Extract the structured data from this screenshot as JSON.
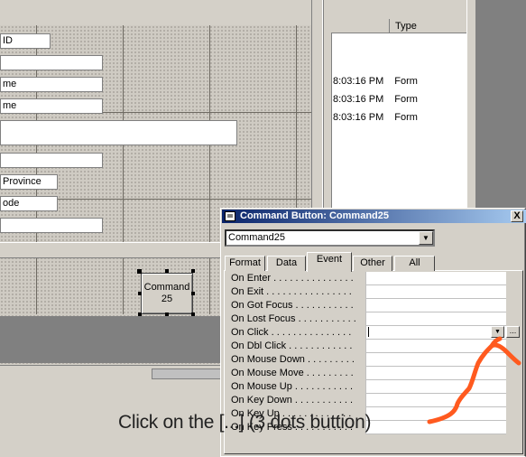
{
  "form": {
    "fields": [
      {
        "text": "ID"
      },
      {
        "text": ""
      },
      {
        "text": "me"
      },
      {
        "text": "me"
      },
      {
        "text": ""
      },
      {
        "text": ""
      },
      {
        "text": "Province"
      },
      {
        "text": "ode"
      },
      {
        "text": ""
      }
    ],
    "command_button": {
      "line1": "Command",
      "line2": "25"
    }
  },
  "object_list": {
    "columns": [
      "",
      "Type"
    ],
    "rows": [
      {
        "time": "8:03:16 PM",
        "type": "Form"
      },
      {
        "time": "8:03:16 PM",
        "type": "Form"
      },
      {
        "time": "8:03:16 PM",
        "type": "Form"
      }
    ]
  },
  "property_sheet": {
    "title": "Command Button: Command25",
    "close_label": "X",
    "selector_value": "Command25",
    "tabs": [
      "Format",
      "Data",
      "Event",
      "Other",
      "All"
    ],
    "active_tab": "Event",
    "properties": [
      "On Enter . . . . . . . . . . . . . . .",
      "On Exit . . . . . . . . . . . . . . . .",
      "On Got Focus . . . . . . . . . . .",
      "On Lost Focus . . . . . . . . . . .",
      "On Click . . . . . . . . . . . . . . .",
      "On Dbl Click . . . . . . . . . . . .",
      "On Mouse Down . . . . . . . . .",
      "On Mouse Move . . . . . . . . .",
      "On Mouse Up . . . . . . . . . . .",
      "On Key Down . . . . . . . . . . .",
      "On Key Up . . . . . . . . . . . . .",
      "On Key Press . . . . . . . . . . ."
    ],
    "builder_label": "...",
    "dropdown_label": "▼"
  },
  "annotation": {
    "caption": "Click on the [...] (3 dots buttion)",
    "arrow_color": "#ff5a1f"
  }
}
